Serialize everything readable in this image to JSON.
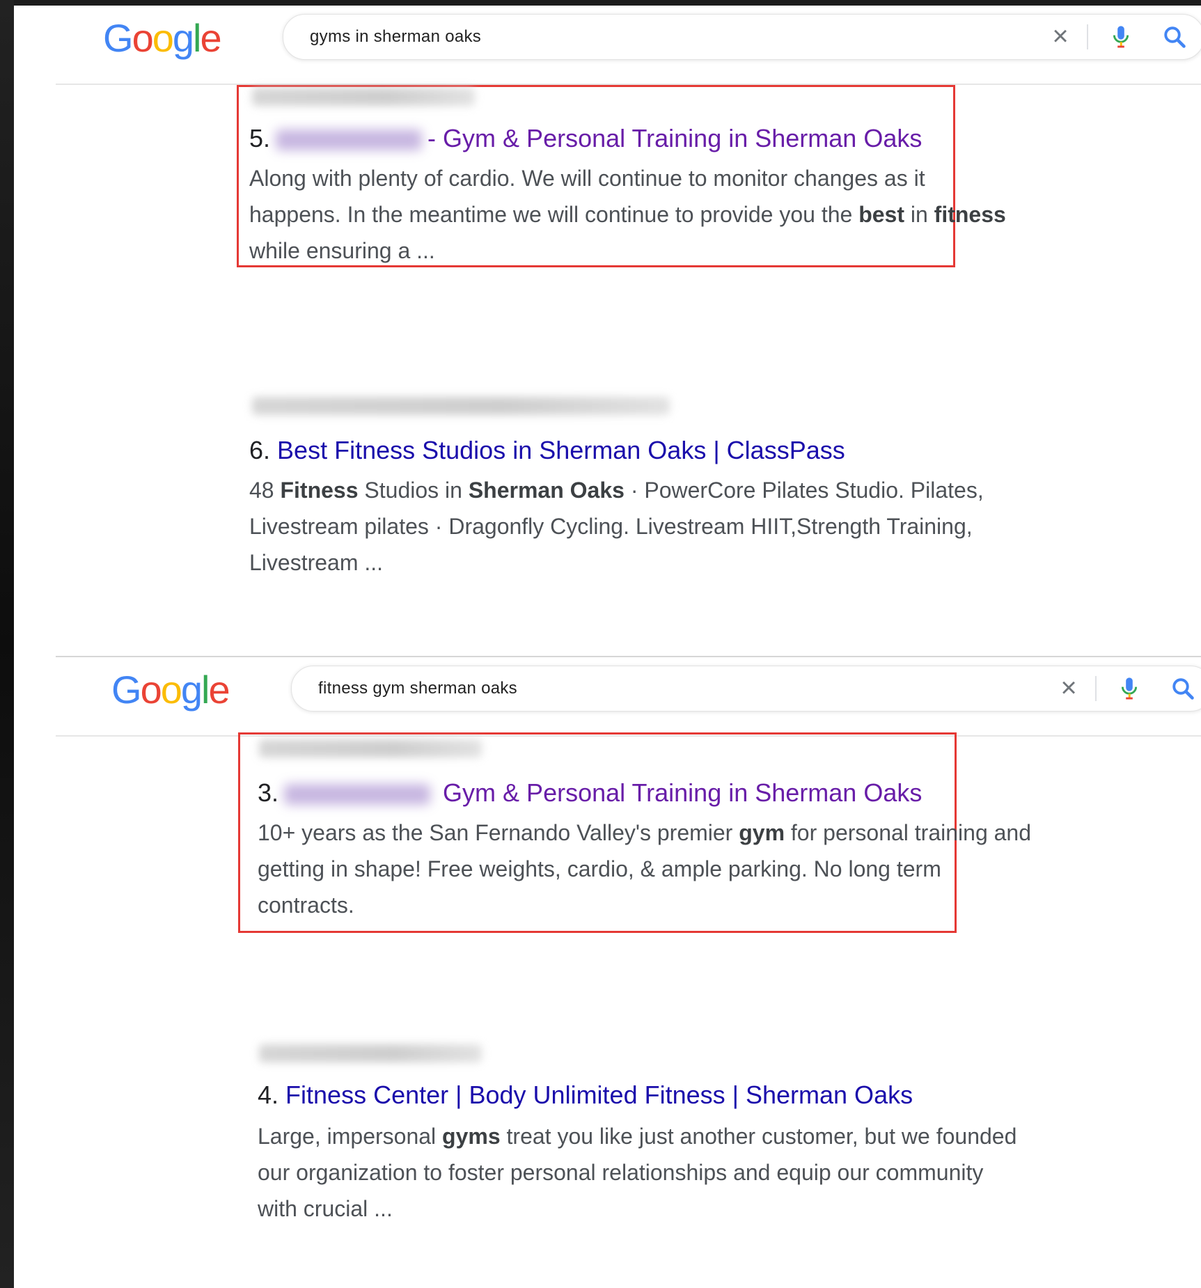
{
  "screenshots": [
    {
      "search": {
        "logo": "Google",
        "query": "gyms in sherman oaks"
      },
      "results": [
        {
          "number": "5.",
          "title_prefix": "-",
          "title": "Gym & Personal Training in Sherman Oaks",
          "title_visited": true,
          "snippet_lines": [
            {
              "parts": [
                {
                  "t": "Along with plenty of cardio. We will continue to monitor changes as it",
                  "b": false
                }
              ]
            },
            {
              "parts": [
                {
                  "t": "happens. In the meantime we will continue to provide you the ",
                  "b": false
                },
                {
                  "t": "best",
                  "b": true
                },
                {
                  "t": " in ",
                  "b": false
                },
                {
                  "t": "fitness",
                  "b": true
                }
              ]
            },
            {
              "parts": [
                {
                  "t": "while ensuring a ...",
                  "b": false
                }
              ]
            }
          ],
          "highlighted": true
        },
        {
          "number": "6.",
          "title": "Best Fitness Studios in Sherman Oaks | ClassPass",
          "title_visited": false,
          "snippet_lines": [
            {
              "parts": [
                {
                  "t": "48 ",
                  "b": false
                },
                {
                  "t": "Fitness",
                  "b": true
                },
                {
                  "t": " Studios in ",
                  "b": false
                },
                {
                  "t": "Sherman Oaks",
                  "b": true
                },
                {
                  "t": " · PowerCore Pilates Studio. Pilates,",
                  "b": false
                }
              ]
            },
            {
              "parts": [
                {
                  "t": "Livestream pilates · Dragonfly Cycling. Livestream HIIT,Strength Training,",
                  "b": false
                }
              ]
            },
            {
              "parts": [
                {
                  "t": "Livestream ...",
                  "b": false
                }
              ]
            }
          ],
          "highlighted": false
        }
      ]
    },
    {
      "search": {
        "logo": "Google",
        "query": "fitness gym sherman oaks"
      },
      "results": [
        {
          "number": "3.",
          "title": "Gym & Personal Training in Sherman Oaks",
          "title_visited": true,
          "snippet_lines": [
            {
              "parts": [
                {
                  "t": "10+ years as the San Fernando Valley's premier ",
                  "b": false
                },
                {
                  "t": "gym",
                  "b": true
                },
                {
                  "t": " for personal training and",
                  "b": false
                }
              ]
            },
            {
              "parts": [
                {
                  "t": "getting in shape! Free weights, cardio, & ample parking. No long term",
                  "b": false
                }
              ]
            },
            {
              "parts": [
                {
                  "t": "contracts.",
                  "b": false
                }
              ]
            }
          ],
          "highlighted": true
        },
        {
          "number": "4.",
          "title": "Fitness Center | Body Unlimited Fitness | Sherman Oaks",
          "title_visited": false,
          "snippet_lines": [
            {
              "parts": [
                {
                  "t": "Large, impersonal ",
                  "b": false
                },
                {
                  "t": "gyms",
                  "b": true
                },
                {
                  "t": " treat you like just another customer, but we founded",
                  "b": false
                }
              ]
            },
            {
              "parts": [
                {
                  "t": "our organization to foster personal relationships and equip our community",
                  "b": false
                }
              ]
            },
            {
              "parts": [
                {
                  "t": "with crucial ...",
                  "b": false
                }
              ]
            }
          ],
          "highlighted": false
        }
      ]
    }
  ],
  "icons": {
    "clear": "close-icon",
    "mic": "microphone-icon",
    "search": "search-icon"
  },
  "colors": {
    "link": "#1a0dab",
    "visited": "#681da8",
    "snippet": "#4d5156",
    "highlight": "#e53935"
  }
}
